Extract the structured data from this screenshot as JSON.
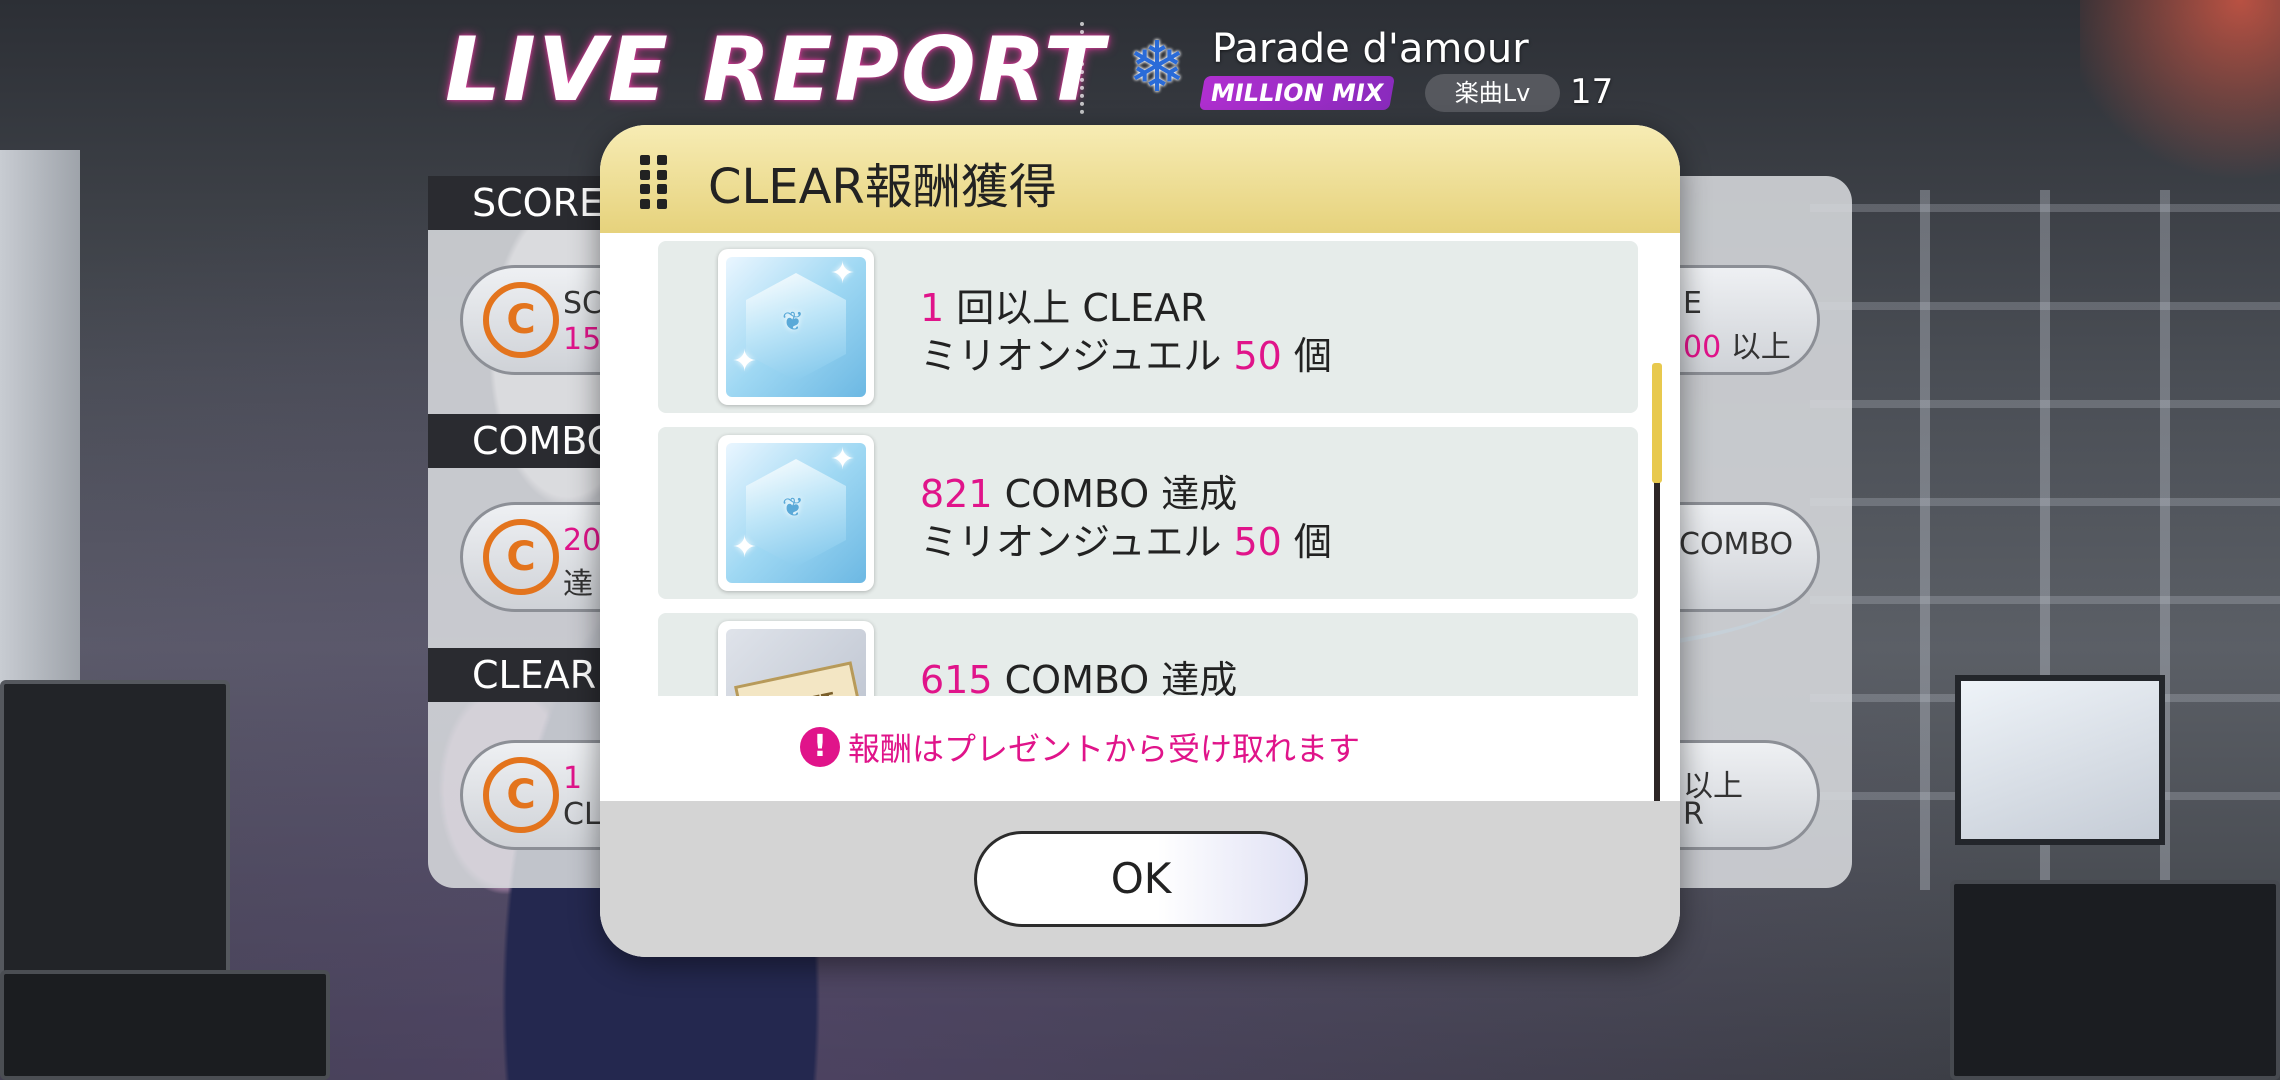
{
  "header": {
    "live_report": "LIVE REPORT",
    "song_title": "Parade d'amour",
    "mix_badge": "MILLION MIX",
    "level_label": "楽曲Lv",
    "level_value": "17"
  },
  "report": {
    "score_label": "SCORE",
    "combo_label": "COMBO",
    "clear_label": "CLEAR",
    "score_row": {
      "left1": "SC",
      "left2": "15",
      "right1": "E",
      "right2_num": "00",
      "right2_suffix": "以上"
    },
    "combo_row": {
      "left1": "20",
      "left2": "達",
      "right1": "COMBO"
    },
    "clear_row": {
      "left1": "1",
      "left2": "CL",
      "right1": "以上",
      "right2": "R"
    }
  },
  "modal": {
    "title": "CLEAR報酬獲得",
    "rewards": [
      {
        "cond_num": "1",
        "cond_text": "回以上 CLEAR",
        "item_name": "ミリオンジュエル",
        "qty": "50",
        "unit": "個",
        "icon": "million-jewel-icon"
      },
      {
        "cond_num": "821",
        "cond_text": "COMBO 達成",
        "item_name": "ミリオンジュエル",
        "qty": "50",
        "unit": "個",
        "icon": "million-jewel-icon"
      },
      {
        "cond_num": "615",
        "cond_text": "COMBO 達成",
        "icon": "ticket-icon",
        "ticket_text": "TICKET"
      }
    ],
    "notice": "報酬はプレゼントから受け取れます",
    "ok_label": "OK"
  },
  "colors": {
    "accent_pink": "#e0148a",
    "header_gold": "#e6d27c",
    "mix_purple": "#b02fd0",
    "scroll_thumb": "#e8c94e"
  }
}
